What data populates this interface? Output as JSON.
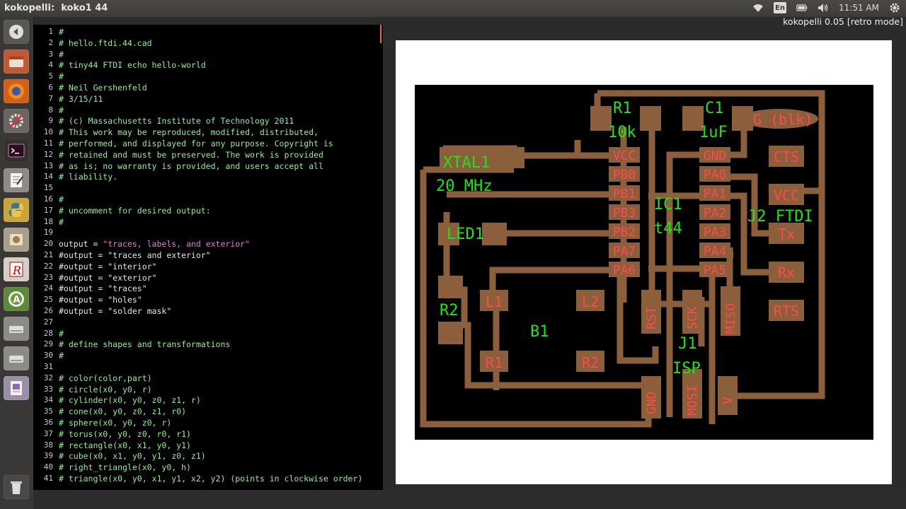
{
  "topbar": {
    "window_title": "kokopelli:  koko1 44",
    "clock": "11:51 AM",
    "keyboard": "En"
  },
  "status": {
    "label": "kokopelli 0.05 [retro mode]"
  },
  "launcher": {
    "items": [
      {
        "name": "launcher-back-icon",
        "bg": "#5a5855"
      },
      {
        "name": "files-icon",
        "bg": "#c05a36"
      },
      {
        "name": "firefox-icon",
        "bg": "#d0611b"
      },
      {
        "name": "settings-icon",
        "bg": "#6b6561"
      },
      {
        "name": "terminal-icon",
        "bg": "#33302e"
      },
      {
        "name": "text-editor-icon",
        "bg": "#8e8a84"
      },
      {
        "name": "python-icon",
        "bg": "#c9a63c"
      },
      {
        "name": "utility-icon",
        "bg": "#a89f89"
      },
      {
        "name": "r-icon",
        "bg": "#d4d0c8"
      },
      {
        "name": "circle-a-icon",
        "bg": "#5b8a3a"
      },
      {
        "name": "drive-icon",
        "bg": "#8d8b88"
      },
      {
        "name": "drive-2-icon",
        "bg": "#8d8b88"
      },
      {
        "name": "document-icon",
        "bg": "#9b8fa6"
      },
      {
        "name": "trash-icon",
        "bg": "#4a4846"
      }
    ]
  },
  "editor": {
    "lines": [
      {
        "n": "1",
        "t": "#"
      },
      {
        "n": "2",
        "t": "# hello.ftdi.44.cad"
      },
      {
        "n": "3",
        "t": "#"
      },
      {
        "n": "4",
        "t": "# tiny44 FTDI echo hello-world"
      },
      {
        "n": "5",
        "t": "#"
      },
      {
        "n": "6",
        "t": "# Neil Gershenfeld"
      },
      {
        "n": "7",
        "t": "# 3/15/11"
      },
      {
        "n": "8",
        "t": "#"
      },
      {
        "n": "9",
        "t": "# (c) Massachusetts Institute of Technology 2011"
      },
      {
        "n": "10",
        "t": "# This work may be reproduced, modified, distributed,"
      },
      {
        "n": "11",
        "t": "# performed, and displayed for any purpose. Copyright is"
      },
      {
        "n": "12",
        "t": "# retained and must be preserved. The work is provided"
      },
      {
        "n": "13",
        "t": "# as is; no warranty is provided, and users accept all"
      },
      {
        "n": "14",
        "t": "# liability."
      },
      {
        "n": "15",
        "t": ""
      },
      {
        "n": "16",
        "t": "#"
      },
      {
        "n": "17",
        "t": "# uncomment for desired output:"
      },
      {
        "n": "18",
        "t": "#"
      },
      {
        "n": "19",
        "t": ""
      },
      {
        "n": "20",
        "t": "output = ",
        "s": "\"traces, labels, and exterior\""
      },
      {
        "n": "21",
        "t": "#output = \"traces and exterior\""
      },
      {
        "n": "22",
        "t": "#output = \"interior\""
      },
      {
        "n": "23",
        "t": "#output = \"exterior\""
      },
      {
        "n": "24",
        "t": "#output = \"traces\""
      },
      {
        "n": "25",
        "t": "#output = \"holes\""
      },
      {
        "n": "26",
        "t": "#output = \"solder mask\""
      },
      {
        "n": "27",
        "t": ""
      },
      {
        "n": "28",
        "t": "#"
      },
      {
        "n": "29",
        "t": "# define shapes and transformations"
      },
      {
        "n": "30",
        "t": "#"
      },
      {
        "n": "31",
        "t": ""
      },
      {
        "n": "32",
        "t": "# color(color,part)"
      },
      {
        "n": "33",
        "t": "# circle(x0, y0, r)"
      },
      {
        "n": "34",
        "t": "# cylinder(x0, y0, z0, z1, r)"
      },
      {
        "n": "35",
        "t": "# cone(x0, y0, z0, z1, r0)"
      },
      {
        "n": "36",
        "t": "# sphere(x0, y0, z0, r)"
      },
      {
        "n": "37",
        "t": "# torus(x0, y0, z0, r0, r1)"
      },
      {
        "n": "38",
        "t": "# rectangle(x0, x1, y0, y1)"
      },
      {
        "n": "39",
        "t": "# cube(x0, x1, y0, y1, z0, z1)"
      },
      {
        "n": "40",
        "t": "# right_triangle(x0, y0, h)"
      },
      {
        "n": "41",
        "t": "# triangle(x0, y0, x1, y1, x2, y2) (points in clockwise order)"
      }
    ]
  },
  "board": {
    "labels": {
      "r1": "R1",
      "r1v": "10k",
      "c1": "C1",
      "c1v": "1uF",
      "gblk": "G (blk)",
      "xtal": "XTAL1",
      "xtalv": "20 MHz",
      "ic1": "IC1",
      "t44": "t44",
      "j2": "J2 FTDI",
      "led1": "LED1",
      "r2": "R2",
      "b1": "B1",
      "j1": "J1",
      "isp": "ISP"
    },
    "pins_left": [
      "VCC",
      "PB0",
      "PB1",
      "PB3",
      "PB2",
      "PA7",
      "PA6"
    ],
    "pins_right": [
      "GND",
      "PA0",
      "PA1",
      "PA2",
      "PA3",
      "PA4",
      "PA5"
    ],
    "ftdi": [
      "CTS",
      "VCC",
      "Tx",
      "Rx",
      "RTS"
    ],
    "pads": {
      "l1": "L1",
      "l2": "L2",
      "r1b": "R1",
      "r2b": "R2"
    },
    "vert": {
      "rst": "RST",
      "sck": "SCK",
      "miso": "MISO",
      "gnd": "GND",
      "mosi": "MOSI",
      "v": "V"
    },
    "colors": {
      "trace": "#8b5e3c",
      "label": "#19e619",
      "pad_text": "#ff4a4a"
    }
  }
}
